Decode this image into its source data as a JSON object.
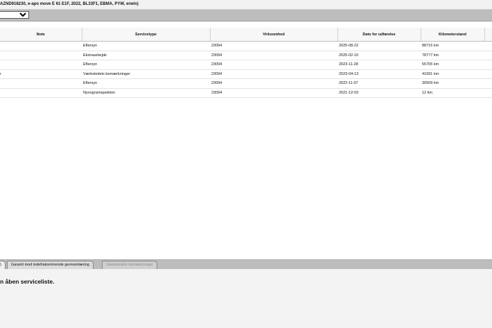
{
  "window": {
    "title": "AZND918230, e-apo move E 61 E1F, 2022, BL33F1, EBMA, PYW, erwin)"
  },
  "toolbar": {
    "selected_option": ""
  },
  "table": {
    "columns": [
      "Note",
      "Servicetype",
      "Virksomhed",
      "Dato for udførelse",
      "Kilometerstand",
      ""
    ],
    "rows": [
      {
        "note": "",
        "servicetype": "Eftersyn",
        "virksomhed": "23094",
        "dato": "2025-08-22",
        "km": "88716 km"
      },
      {
        "note": "",
        "servicetype": "Ekstraarbejde",
        "virksomhed": "23094",
        "dato": "2025-02-10",
        "km": "78777 km"
      },
      {
        "note": "",
        "servicetype": "Eftersyn",
        "virksomhed": "23094",
        "dato": "2023-11-28",
        "km": "55705 km"
      },
      {
        "note": "r",
        "servicetype": "Værkstedets bemærkninger",
        "virksomhed": "23094",
        "dato": "2023-04-13",
        "km": "41691 km"
      },
      {
        "note": "",
        "servicetype": "Eftersyn",
        "virksomhed": "23094",
        "dato": "2022-11-07",
        "km": "30509 km"
      },
      {
        "note": "",
        "servicetype": "Nyvognsinspektion",
        "virksomhed": "23094",
        "dato": "2021-12-03",
        "km": "12 km"
      }
    ]
  },
  "tabs": [
    {
      "label": ")",
      "state": "active"
    },
    {
      "label": "Garanti mod indefrakommende gennemtæring",
      "state": "normal"
    },
    {
      "label": "Værkstedets bemærkninger",
      "state": "disabled"
    }
  ],
  "bottom": {
    "message": "n åben serviceliste."
  }
}
